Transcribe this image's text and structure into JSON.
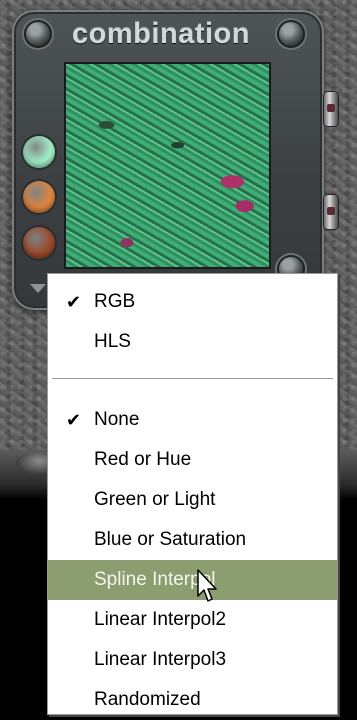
{
  "panel": {
    "title": "combination",
    "color_swatches": [
      "#9ff0c6",
      "#e0853e",
      "#9b4a2c"
    ],
    "preview_texture": "green-crackle-texture"
  },
  "menu": {
    "mode_items": [
      {
        "label": "RGB",
        "checked": true
      },
      {
        "label": "HLS",
        "checked": false
      }
    ],
    "channel_items": [
      {
        "label": "None",
        "checked": true
      },
      {
        "label": "Red or Hue",
        "checked": false
      },
      {
        "label": "Green or Light",
        "checked": false
      },
      {
        "label": "Blue or Saturation",
        "checked": false
      },
      {
        "label": "Spline Interpol",
        "checked": false,
        "highlighted": true
      },
      {
        "label": "Linear Interpol2",
        "checked": false
      },
      {
        "label": "Linear Interpol3",
        "checked": false
      },
      {
        "label": "Randomized",
        "checked": false
      }
    ],
    "check_glyph": "✔",
    "highlight_color": "#8c9d6f"
  }
}
